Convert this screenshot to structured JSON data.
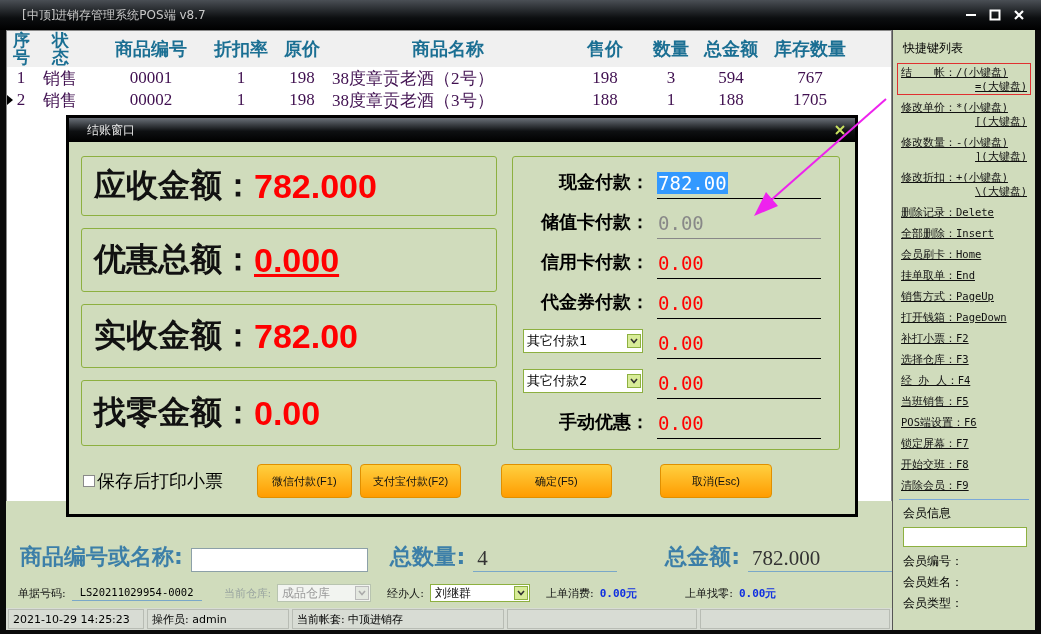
{
  "window": {
    "title": "[中顶]进销存管理系统POS端 v8.7"
  },
  "table": {
    "columns": [
      {
        "label": "序号",
        "kind": "stacked"
      },
      {
        "label": "状态",
        "kind": "stacked"
      },
      {
        "label": "商品编号",
        "kind": "plain"
      },
      {
        "label": "折扣率",
        "kind": "plain"
      },
      {
        "label": "原价",
        "kind": "plain"
      },
      {
        "label": "商品名称",
        "kind": "plain"
      },
      {
        "label": "售价",
        "kind": "plain"
      },
      {
        "label": "数量",
        "kind": "plain"
      },
      {
        "label": "总金额",
        "kind": "plain"
      },
      {
        "label": "库存数量",
        "kind": "plain"
      }
    ],
    "rows": [
      {
        "selected": false,
        "cells": [
          "1",
          "销售",
          "00001",
          "1",
          "198",
          "38度章贡老酒（2号）",
          "198",
          "3",
          "594",
          "767"
        ]
      },
      {
        "selected": true,
        "cells": [
          "2",
          "销售",
          "00002",
          "1",
          "198",
          "38度章贡老酒（3号）",
          "188",
          "1",
          "188",
          "1705"
        ]
      }
    ]
  },
  "dialog": {
    "title": "结账窗口",
    "summary": [
      {
        "label": "应收金额：",
        "value": "782.000",
        "underlined": false
      },
      {
        "label": "优惠总额：",
        "value": "0.000",
        "underlined": true
      },
      {
        "label": "实收金额：",
        "value": "782.00",
        "underlined": false
      },
      {
        "label": "找零金额：",
        "value": "0.00",
        "underlined": false
      }
    ],
    "payments": [
      {
        "kind": "label",
        "label": "现金付款：",
        "value": "782.00",
        "selected": true,
        "disabled": false
      },
      {
        "kind": "label",
        "label": "储值卡付款：",
        "value": "0.00",
        "selected": false,
        "disabled": true
      },
      {
        "kind": "label",
        "label": "信用卡付款：",
        "value": "0.00",
        "selected": false,
        "disabled": false
      },
      {
        "kind": "label",
        "label": "代金券付款：",
        "value": "0.00",
        "selected": false,
        "disabled": false
      },
      {
        "kind": "select",
        "label": "其它付款1",
        "value": "0.00",
        "selected": false,
        "disabled": false
      },
      {
        "kind": "select",
        "label": "其它付款2",
        "value": "0.00",
        "selected": false,
        "disabled": false
      },
      {
        "kind": "label",
        "label": "手动优惠：",
        "value": "0.00",
        "selected": false,
        "disabled": false
      }
    ],
    "print_checkbox": {
      "label": "保存后打印小票",
      "checked": false
    },
    "buttons": [
      "微信付款(F1)",
      "支付宝付款(F2)",
      "确定(F5)",
      "取消(Esc)"
    ]
  },
  "sidebar": {
    "title": "快捷键列表",
    "shortcuts": [
      {
        "highlighted": true,
        "lines": [
          "结　　帐：/(小键盘)",
          "=(大键盘)"
        ]
      },
      {
        "highlighted": false,
        "lines": [
          "修改单价：*(小键盘)",
          "[(大键盘)"
        ]
      },
      {
        "highlighted": false,
        "lines": [
          "修改数量：-(小键盘)",
          "](大键盘)"
        ]
      },
      {
        "highlighted": false,
        "lines": [
          "修改折扣：+(小键盘)",
          "\\(大键盘)"
        ]
      },
      {
        "highlighted": false,
        "lines": [
          "删除记录：Delete"
        ]
      },
      {
        "highlighted": false,
        "lines": [
          "全部删除：Insert"
        ]
      },
      {
        "highlighted": false,
        "lines": [
          "会员刷卡：Home"
        ]
      },
      {
        "highlighted": false,
        "lines": [
          "挂单取单：End"
        ]
      },
      {
        "highlighted": false,
        "lines": [
          "销售方式：PageUp"
        ]
      },
      {
        "highlighted": false,
        "lines": [
          "打开钱箱：PageDown"
        ]
      },
      {
        "highlighted": false,
        "lines": [
          "补打小票：F2"
        ]
      },
      {
        "highlighted": false,
        "lines": [
          "选择仓库：F3"
        ]
      },
      {
        "highlighted": false,
        "lines": [
          "经 办 人：F4"
        ]
      },
      {
        "highlighted": false,
        "lines": [
          "当班销售：F5"
        ]
      },
      {
        "highlighted": false,
        "lines": [
          "POS端设置：F6"
        ]
      },
      {
        "highlighted": false,
        "lines": [
          "锁定屏幕：F7"
        ]
      },
      {
        "highlighted": false,
        "lines": [
          "开始交班：F8"
        ]
      },
      {
        "highlighted": false,
        "lines": [
          "清除会员：F9"
        ]
      }
    ],
    "member": {
      "title": "会员信息",
      "fields": [
        "会员编号：",
        "会员姓名：",
        "会员类型："
      ]
    }
  },
  "search_bar": {
    "product_label": "商品编号或名称:",
    "qty_label": "总数量:",
    "qty_value": "4",
    "total_label": "总金额:",
    "total_value": "782.000"
  },
  "info_bar": {
    "bill_label": "单据号码:",
    "bill_value": "LS20211029954-0002",
    "warehouse_label": "当前仓库:",
    "warehouse_value": "成品仓库",
    "warehouse_disabled": true,
    "handler_label": "经办人:",
    "handler_value": "刘继群",
    "last_spend_label": "上单消费:",
    "last_spend_value": "0.00元",
    "last_change_label": "上单找零:",
    "last_change_value": "0.00元"
  },
  "status_bar": [
    "2021-10-29 14:25:23",
    "操作员: admin",
    "当前帐套: 中顶进销存"
  ]
}
